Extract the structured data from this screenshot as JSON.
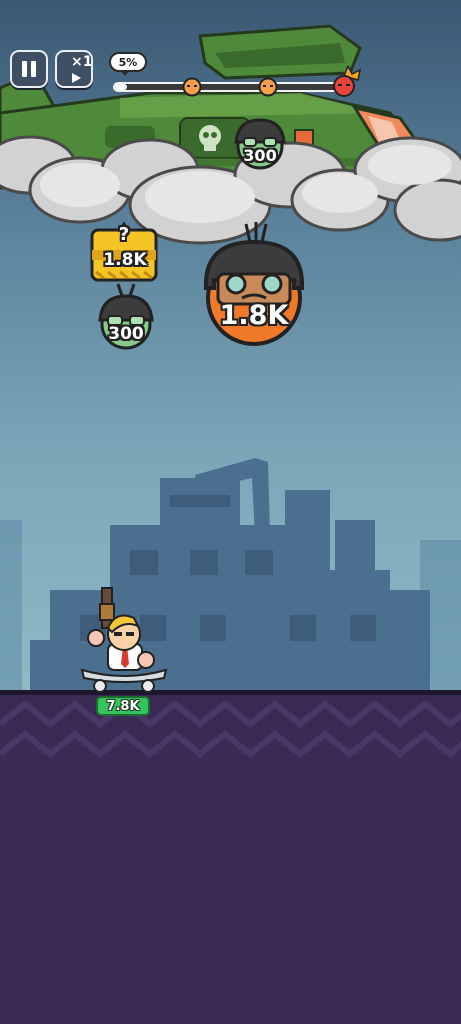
{
  "hud": {
    "pause_icon": "pause-icon",
    "speed_label": "×1",
    "speed_icon": "play-icon",
    "progress_percent_label": "5%",
    "progress_fraction": 0.05,
    "waypoint_icons": [
      "enemy-face-icon",
      "enemy-face-icon",
      "boss-face-icon"
    ]
  },
  "enemies": {
    "boss_value": "1.8K",
    "heli_soldier_value": "300",
    "small_soldier_value": "300"
  },
  "crate": {
    "label": "?",
    "value": "1.8K"
  },
  "player": {
    "power_value": "7.8K"
  },
  "colors": {
    "player_badge": "#35c45e",
    "boss": "#f07a2a",
    "helicopter": "#4e8a3a",
    "crate": "#f5c526",
    "ground": "#3b2b54"
  }
}
